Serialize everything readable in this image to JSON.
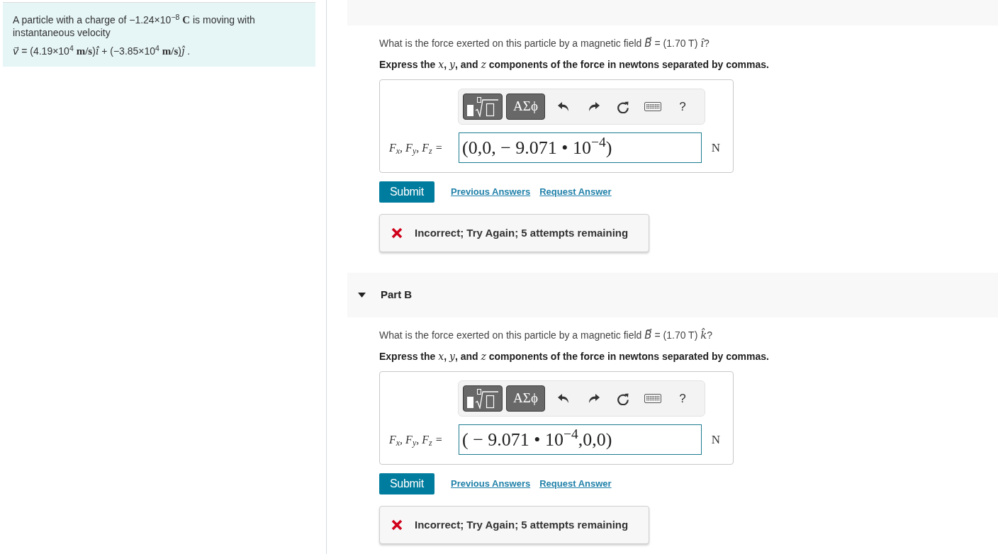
{
  "problem": {
    "text": "A particle with a charge of −1.24×10$^{−8}$ **C** is moving with instantaneous velocity",
    "equation": "*v⃗* = (4.19×10$^{4}$ **m/s**)*î* + (−3.85×10$^{4}$ **m/s**)*ĵ* ."
  },
  "parts": [
    {
      "question": "What is the force exerted on this particle by a magnetic field *B⃗* = (1.70 T) *î*?",
      "instruction": "Express the *x*, *y*, and *z* components of the force in newtons separated by commas.",
      "answer": {
        "toolbar": [
          {
            "kind": "templates"
          },
          {
            "kind": "symbols",
            "label": "ΑΣϕ"
          },
          {
            "kind": "undo"
          },
          {
            "kind": "redo"
          },
          {
            "kind": "reset"
          },
          {
            "kind": "keyboard"
          },
          {
            "kind": "help",
            "label": "?"
          }
        ],
        "label": "F$_{x}$, F$_{y}$, F$_{z}$ =",
        "value": "(0,0, − 9.071 • 10$^{−4}$)",
        "unit": "N"
      },
      "buttons": [
        {
          "kind": "submit",
          "label": "Submit"
        },
        {
          "kind": "link",
          "label": "Previous Answers"
        },
        {
          "kind": "link",
          "label": "Request Answer"
        }
      ],
      "feedback": {
        "kind": "incorrect",
        "text": "Incorrect; Try Again; 5 attempts remaining"
      }
    },
    {
      "header": {
        "title": "Part B",
        "expanded": true
      },
      "question": "What is the force exerted on this particle by a magnetic field *B⃗* = (1.70 T) *k̂*?",
      "instruction": "Express the *x*, *y*, and *z* components of the force in newtons separated by commas.",
      "answer": {
        "toolbar": [
          {
            "kind": "templates"
          },
          {
            "kind": "symbols",
            "label": "ΑΣϕ"
          },
          {
            "kind": "undo"
          },
          {
            "kind": "redo"
          },
          {
            "kind": "reset"
          },
          {
            "kind": "keyboard"
          },
          {
            "kind": "help",
            "label": "?"
          }
        ],
        "label": "F$_{x}$, F$_{y}$, F$_{z}$ =",
        "value": "( − 9.071 • 10$^{−4}$,0,0)",
        "unit": "N"
      },
      "buttons": [
        {
          "kind": "submit",
          "label": "Submit"
        },
        {
          "kind": "link",
          "label": "Previous Answers"
        },
        {
          "kind": "link",
          "label": "Request Answer"
        }
      ],
      "feedback": {
        "kind": "incorrect",
        "text": "Incorrect; Try Again; 5 attempts remaining"
      }
    }
  ]
}
